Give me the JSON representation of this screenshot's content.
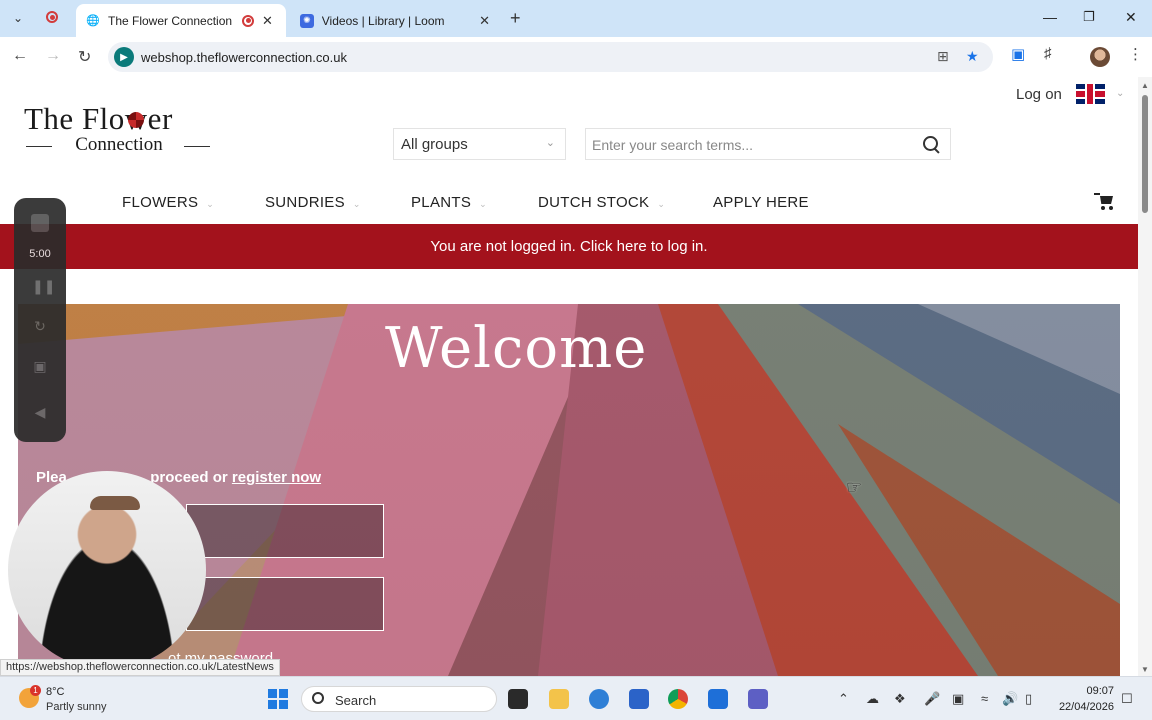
{
  "browser": {
    "tabs": [
      {
        "title": "The Flower Connection | W"
      },
      {
        "title": "Videos | Library | Loom"
      }
    ],
    "url": "webshop.theflowerconnection.co.uk"
  },
  "site": {
    "logo": {
      "line1": "The Flower",
      "line2": "Connection"
    },
    "logon": "Log on",
    "groups_select": "All groups",
    "search_placeholder": "Enter your search terms...",
    "nav": [
      {
        "label": "FLOWERS"
      },
      {
        "label": "SUNDRIES"
      },
      {
        "label": "PLANTS"
      },
      {
        "label": "DUTCH STOCK"
      },
      {
        "label": "APPLY HERE"
      }
    ],
    "banner": "You are not logged in. Click here to log in.",
    "hero": {
      "prompt_before": "Plea",
      "prompt_after": " proceed or ",
      "register_link": "register now",
      "forgot_link": "ot my password",
      "welcome": "Welcome"
    }
  },
  "recorder": {
    "time": "5:00"
  },
  "status_url": "https://webshop.theflowerconnection.co.uk/LatestNews",
  "taskbar": {
    "weather_badge": "1",
    "temperature": "8°C",
    "condition": "Partly sunny",
    "search_label": "Search",
    "time": "09:07",
    "date": "22/04/2026"
  },
  "colors": {
    "banner": "#a3121c",
    "tabstrip": "#cfe4f8"
  }
}
